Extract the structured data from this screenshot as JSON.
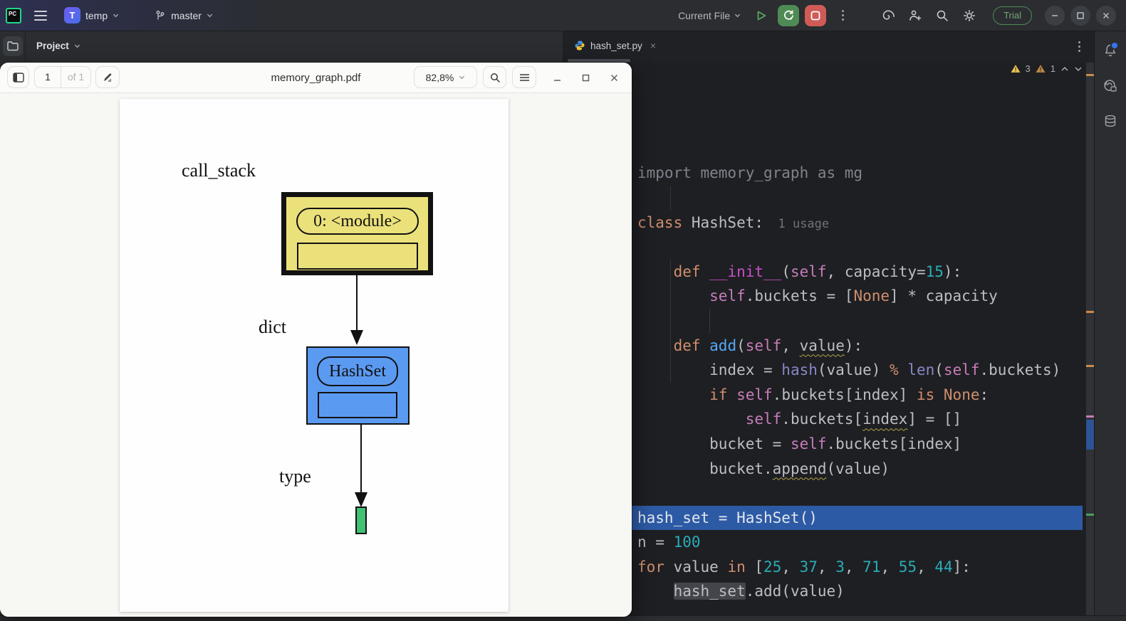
{
  "titlebar": {
    "project_initial": "T",
    "project": "temp",
    "branch": "master",
    "run_config": "Current File",
    "trial_badge": "Trial"
  },
  "project_panel": {
    "title": "Project"
  },
  "editor": {
    "tab": "hash_set.py",
    "warnings": {
      "weak_count": "3",
      "medium_count": "1"
    }
  },
  "pdf_viewer": {
    "title": "memory_graph.pdf",
    "page_current": "1",
    "page_of": "of 1",
    "zoom_level": "82,8%"
  },
  "graph": {
    "label_call_stack": "call_stack",
    "label_dict": "dict",
    "label_type": "type",
    "node_module": "0: <module>",
    "node_hashset": "HashSet"
  },
  "colors": {
    "selection": "#2D5AA5",
    "node_yellow": "#EBE17B",
    "node_blue": "#5B9AF1",
    "node_green": "#40C173",
    "run_green": "#4F8B55",
    "stop_red": "#D05B56",
    "tok_kw": "#CF8E6D",
    "tok_text": "#BCBEC4",
    "tok_gray": "#7F838C",
    "tok_func": "#56A8F5",
    "tok_magic": "#C84FC9",
    "tok_self": "#C77DBB",
    "tok_num": "#2AACB8",
    "tok_builtin": "#8888C6"
  },
  "code": {
    "lines": [
      {
        "toks": [
          {
            "t": "import memory_graph as mg",
            "c": "gray"
          }
        ]
      },
      {
        "toks": []
      },
      {
        "toks": [
          {
            "t": "class ",
            "c": "kw"
          },
          {
            "t": "HashSet:",
            "c": "text"
          },
          {
            "t": "  1 usage",
            "c": "inlay"
          }
        ]
      },
      {
        "toks": []
      },
      {
        "toks": [
          {
            "t": "    ",
            "c": "text"
          },
          {
            "t": "def ",
            "c": "kw"
          },
          {
            "t": "__init__",
            "c": "magic"
          },
          {
            "t": "(",
            "c": "text"
          },
          {
            "t": "self",
            "c": "self"
          },
          {
            "t": ", capacity=",
            "c": "text"
          },
          {
            "t": "15",
            "c": "num"
          },
          {
            "t": "):",
            "c": "text"
          }
        ]
      },
      {
        "toks": [
          {
            "t": "        ",
            "c": "text"
          },
          {
            "t": "self",
            "c": "self"
          },
          {
            "t": ".buckets = [",
            "c": "text"
          },
          {
            "t": "None",
            "c": "kw"
          },
          {
            "t": "] * capacity",
            "c": "text"
          }
        ]
      },
      {
        "toks": []
      },
      {
        "toks": [
          {
            "t": "    ",
            "c": "text"
          },
          {
            "t": "def ",
            "c": "kw"
          },
          {
            "t": "add",
            "c": "func"
          },
          {
            "t": "(",
            "c": "text"
          },
          {
            "t": "self",
            "c": "self"
          },
          {
            "t": ", ",
            "c": "text"
          },
          {
            "t": "value",
            "c": "text",
            "u": true
          },
          {
            "t": "):",
            "c": "text"
          }
        ]
      },
      {
        "toks": [
          {
            "t": "        index = ",
            "c": "text"
          },
          {
            "t": "hash",
            "c": "builtin"
          },
          {
            "t": "(value) ",
            "c": "text"
          },
          {
            "t": "%",
            "c": "kw"
          },
          {
            "t": " ",
            "c": "text"
          },
          {
            "t": "len",
            "c": "builtin"
          },
          {
            "t": "(",
            "c": "text"
          },
          {
            "t": "self",
            "c": "self"
          },
          {
            "t": ".buckets)",
            "c": "text"
          }
        ]
      },
      {
        "toks": [
          {
            "t": "        ",
            "c": "text"
          },
          {
            "t": "if ",
            "c": "kw"
          },
          {
            "t": "self",
            "c": "self"
          },
          {
            "t": ".buckets[index] ",
            "c": "text"
          },
          {
            "t": "is ",
            "c": "kw"
          },
          {
            "t": "None",
            "c": "kw"
          },
          {
            "t": ":",
            "c": "text"
          }
        ]
      },
      {
        "toks": [
          {
            "t": "            ",
            "c": "text"
          },
          {
            "t": "self",
            "c": "self"
          },
          {
            "t": ".buckets[",
            "c": "text"
          },
          {
            "t": "index",
            "c": "text",
            "u": true
          },
          {
            "t": "] = []",
            "c": "text"
          }
        ]
      },
      {
        "toks": [
          {
            "t": "        bucket = ",
            "c": "text"
          },
          {
            "t": "self",
            "c": "self"
          },
          {
            "t": ".buckets[index]",
            "c": "text"
          }
        ]
      },
      {
        "toks": [
          {
            "t": "        bucket.",
            "c": "text"
          },
          {
            "t": "append",
            "c": "text",
            "u": true
          },
          {
            "t": "(value)",
            "c": "text"
          }
        ]
      },
      {
        "toks": []
      },
      {
        "sel": true,
        "toks": [
          {
            "t": "hash_set = HashSet()",
            "c": "text"
          }
        ]
      },
      {
        "toks": [
          {
            "t": "n = ",
            "c": "text"
          },
          {
            "t": "100",
            "c": "num"
          }
        ]
      },
      {
        "toks": [
          {
            "t": "for ",
            "c": "kw"
          },
          {
            "t": "value ",
            "c": "text"
          },
          {
            "t": "in ",
            "c": "kw"
          },
          {
            "t": "[",
            "c": "text"
          },
          {
            "t": "25",
            "c": "num"
          },
          {
            "t": ", ",
            "c": "text"
          },
          {
            "t": "37",
            "c": "num"
          },
          {
            "t": ", ",
            "c": "text"
          },
          {
            "t": "3",
            "c": "num"
          },
          {
            "t": ", ",
            "c": "text"
          },
          {
            "t": "71",
            "c": "num"
          },
          {
            "t": ", ",
            "c": "text"
          },
          {
            "t": "55",
            "c": "num"
          },
          {
            "t": ", ",
            "c": "text"
          },
          {
            "t": "44",
            "c": "num"
          },
          {
            "t": "]:",
            "c": "text"
          }
        ]
      },
      {
        "toks": [
          {
            "t": "    ",
            "c": "text"
          },
          {
            "t": "hash_set",
            "c": "text",
            "hl": true
          },
          {
            "t": ".add(value)",
            "c": "text"
          }
        ]
      }
    ]
  }
}
